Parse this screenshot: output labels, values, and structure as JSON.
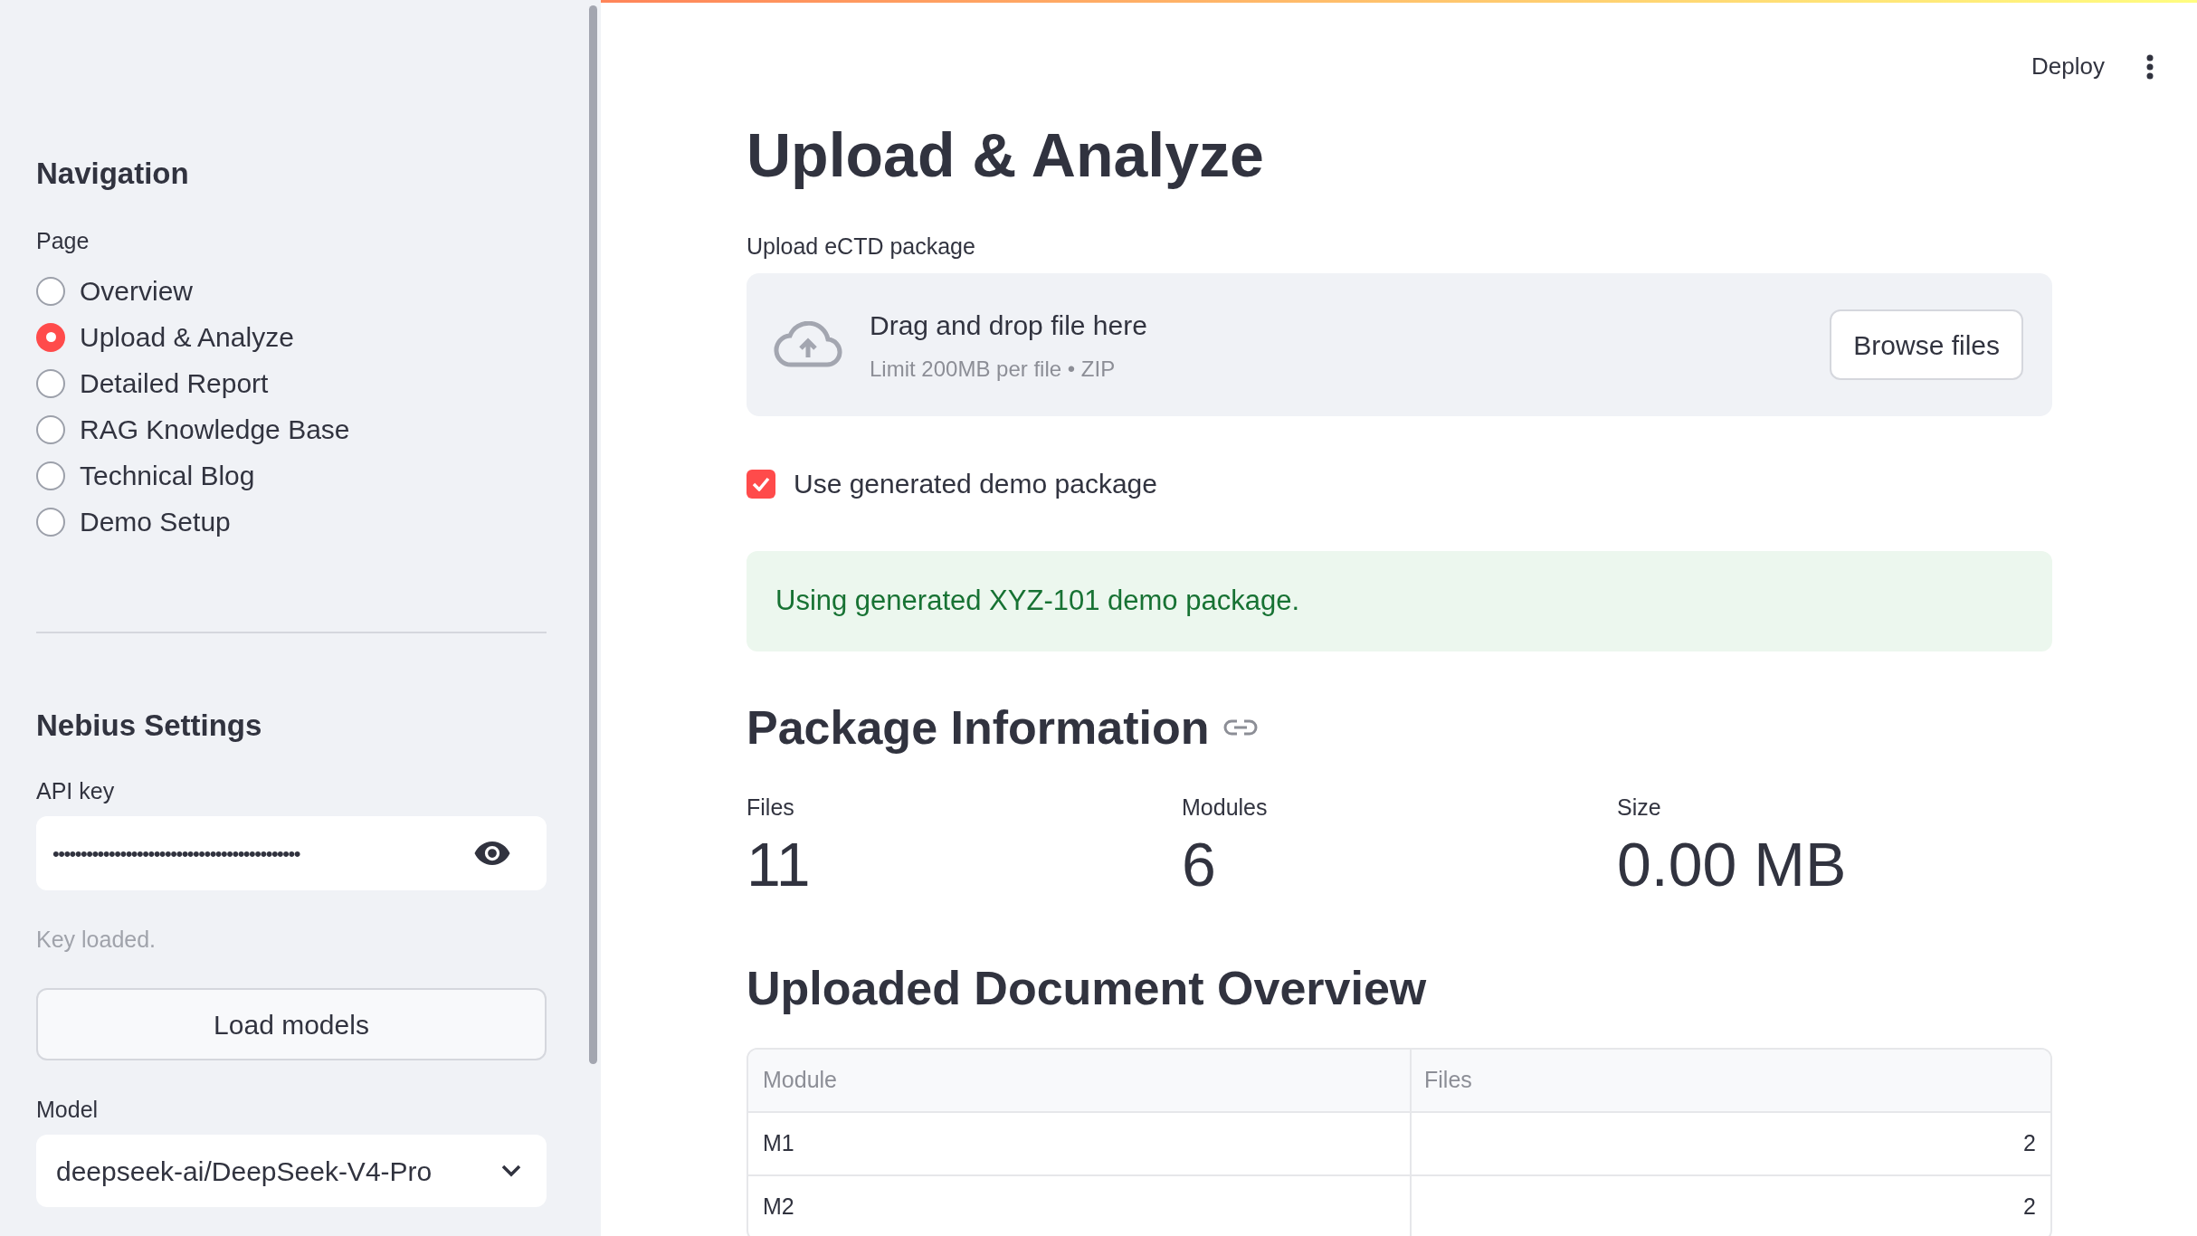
{
  "header": {
    "deploy": "Deploy"
  },
  "sidebar": {
    "navigation_title": "Navigation",
    "page_label": "Page",
    "pages": [
      {
        "label": "Overview",
        "selected": false
      },
      {
        "label": "Upload & Analyze",
        "selected": true
      },
      {
        "label": "Detailed Report",
        "selected": false
      },
      {
        "label": "RAG Knowledge Base",
        "selected": false
      },
      {
        "label": "Technical Blog",
        "selected": false
      },
      {
        "label": "Demo Setup",
        "selected": false
      }
    ],
    "settings_title": "Nebius Settings",
    "api_key": {
      "label": "API key",
      "value": "••••••••••••••••••••••••••••••••••••••••••••"
    },
    "key_status": "Key loaded.",
    "load_button": "Load models",
    "model": {
      "label": "Model",
      "value": "deepseek-ai/DeepSeek-V4-Pro"
    }
  },
  "main": {
    "title": "Upload & Analyze",
    "uploader": {
      "label": "Upload eCTD package",
      "instruction": "Drag and drop file here",
      "limit": "Limit 200MB per file • ZIP",
      "button": "Browse files"
    },
    "demo_checkbox": {
      "label": "Use generated demo package",
      "checked": true
    },
    "alert": "Using generated XYZ-101 demo package.",
    "package_title": "Package Information",
    "metrics": [
      {
        "label": "Files",
        "value": "11"
      },
      {
        "label": "Modules",
        "value": "6"
      },
      {
        "label": "Size",
        "value": "0.00 MB"
      }
    ],
    "overview_title": "Uploaded Document Overview",
    "table": {
      "columns": [
        "Module",
        "Files"
      ],
      "rows": [
        [
          "M1",
          "2"
        ],
        [
          "M2",
          "2"
        ]
      ]
    }
  }
}
